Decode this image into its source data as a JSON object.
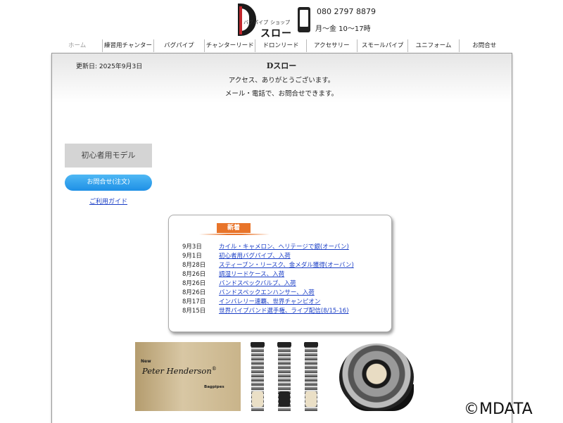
{
  "header": {
    "logo_small_left": "バグパイプ",
    "logo_small_right": "ショップ",
    "logo_main": "スロー",
    "phone": "080 2797 8879",
    "hours": "月～金 10～17時"
  },
  "nav": {
    "items": [
      {
        "label": "ホーム"
      },
      {
        "label": "練習用チャンター"
      },
      {
        "label": "バグパイプ"
      },
      {
        "label": "チャンターリード"
      },
      {
        "label": "ドロンリード"
      },
      {
        "label": "アクセサリー"
      },
      {
        "label": "スモールパイプ"
      },
      {
        "label": "ユニフォーム"
      },
      {
        "label": "お問合せ"
      }
    ]
  },
  "main": {
    "updated": "更新日: 2025年9月3日",
    "title": "Dスロー",
    "welcome_1": "アクセス、ありがとうございます。",
    "welcome_2": "メール・電話で、お問合せできます。"
  },
  "side": {
    "beginner_label": "初心者用モデル",
    "contact_label": "お問合せ(注文)",
    "guide_label": "ご利用ガイド"
  },
  "news": {
    "tag": "新着",
    "items": [
      {
        "date": "9月3日",
        "text": "カイル・キャメロン、ヘリテージで銀(オーバン)"
      },
      {
        "date": "9月1日",
        "text": "初心者用バグパイプ、入荷"
      },
      {
        "date": "8月28日",
        "text": "スティーブン・リースク、金メダル獲得(オーバン)"
      },
      {
        "date": "8月26日",
        "text": "調湿リードケース、入荷"
      },
      {
        "date": "8月26日",
        "text": "バンドスペックバルブ、入荷"
      },
      {
        "date": "8月26日",
        "text": "バンドスペックエンハンサー、入荷"
      },
      {
        "date": "8月17日",
        "text": "インバレリー連覇、世界チャンピオン"
      },
      {
        "date": "8月15日",
        "text": "世界パイプバンド選手権、ライブ配信(8/15-16)"
      }
    ]
  },
  "banner": {
    "new_label": "New",
    "brand": "Peter Henderson",
    "registered": "®",
    "sub": "Bagpipes"
  },
  "watermark": "©MDATA",
  "colors": {
    "accent_orange": "#e8742a",
    "link_blue": "#1a3ec6",
    "button_blue": "#1e90e6",
    "logo_red": "#c0262c"
  }
}
